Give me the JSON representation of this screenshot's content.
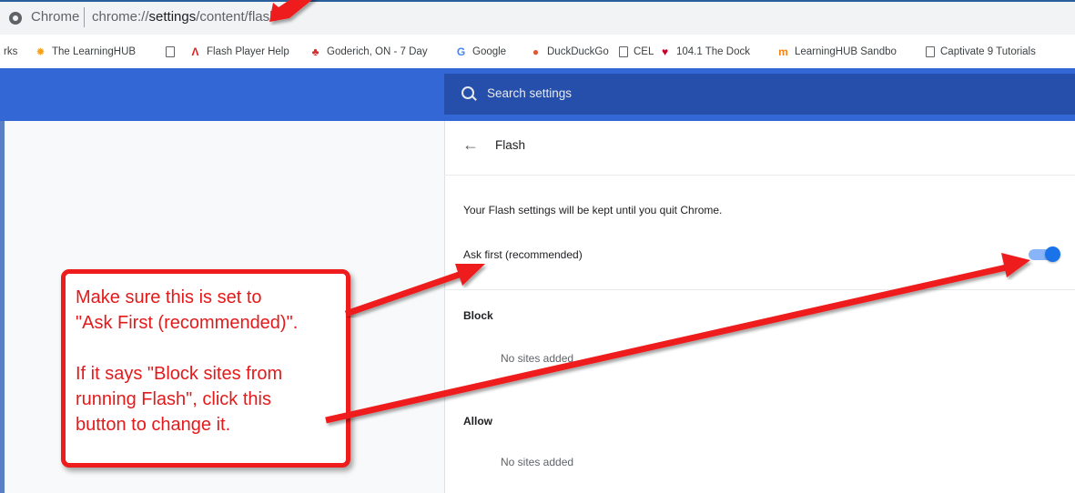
{
  "address_bar": {
    "origin": "Chrome",
    "url_host": "chrome://",
    "url_bold": "settings",
    "url_path": "/content/flash"
  },
  "bookmarks": [
    {
      "label": "rks",
      "icon": "none"
    },
    {
      "label": "The LearningHUB",
      "icon": "gear-icon",
      "color": "#f4a21b"
    },
    {
      "label": "",
      "icon": "page-icon"
    },
    {
      "label": "Flash Player Help",
      "icon": "adobe-icon",
      "color": "#e31c1c"
    },
    {
      "label": "Goderich, ON - 7 Day",
      "icon": "maple-leaf-icon",
      "color": "#d62b2b"
    },
    {
      "label": "Google",
      "icon": "google-icon",
      "color": "#4285f4"
    },
    {
      "label": "DuckDuckGo",
      "icon": "duckduckgo-icon",
      "color": "#de5833"
    },
    {
      "label": "CEL",
      "icon": "page-icon"
    },
    {
      "label": "104.1 The Dock",
      "icon": "iheart-icon",
      "color": "#c6002b"
    },
    {
      "label": "LearningHUB Sandbo",
      "icon": "moodle-icon",
      "color": "#f98012"
    },
    {
      "label": "Captivate 9 Tutorials",
      "icon": "page-icon"
    }
  ],
  "search": {
    "placeholder": "Search settings"
  },
  "page": {
    "title": "Flash",
    "note": "Your Flash settings will be kept until you quit Chrome.",
    "ask_first_label": "Ask first (recommended)",
    "ask_first_enabled": true,
    "block_heading": "Block",
    "block_empty": "No sites added",
    "allow_heading": "Allow",
    "allow_empty": "No sites added"
  },
  "annotation": {
    "line1": "Make sure this is set to",
    "line2": "\"Ask First (recommended)\".",
    "line3": "If it says \"Block sites from",
    "line4": "running Flash\", click this",
    "line5": "button to change it."
  },
  "colors": {
    "header": "#3367d6",
    "search_bg": "#254fab",
    "toggle_on": "#1a73e8",
    "annotation_red": "#ee1c1c"
  }
}
